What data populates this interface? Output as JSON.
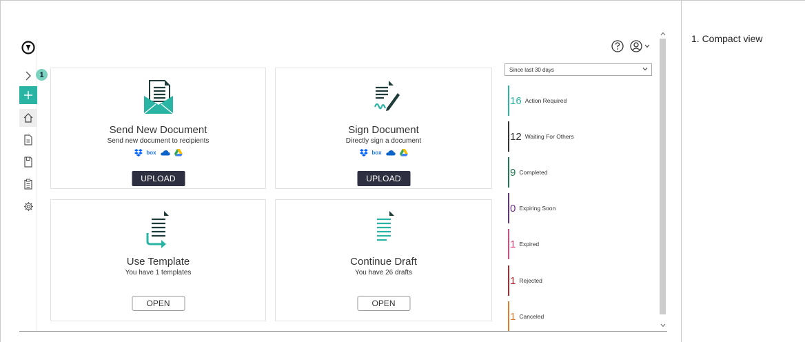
{
  "note": {
    "text": "1.  Compact view"
  },
  "nav": {
    "badge": "1",
    "items": [
      {
        "name": "expand",
        "icon": "chevron-right-icon"
      },
      {
        "name": "new",
        "icon": "plus-icon"
      },
      {
        "name": "home",
        "icon": "home-icon"
      },
      {
        "name": "documents",
        "icon": "document-icon"
      },
      {
        "name": "drafts",
        "icon": "save-icon"
      },
      {
        "name": "templates",
        "icon": "clipboard-icon"
      },
      {
        "name": "settings",
        "icon": "gear-icon"
      }
    ]
  },
  "header": {
    "help_icon": "help-icon",
    "user_icon": "user-icon"
  },
  "cards": {
    "send": {
      "title": "Send New Document",
      "subtitle": "Send new document to recipients",
      "button": "UPLOAD"
    },
    "sign": {
      "title": "Sign Document",
      "subtitle": "Directly sign a document",
      "button": "UPLOAD"
    },
    "template": {
      "title": "Use Template",
      "subtitle": "You have 1 templates",
      "button": "OPEN"
    },
    "draft": {
      "title": "Continue Draft",
      "subtitle": "You have 26 drafts",
      "button": "OPEN"
    }
  },
  "services": {
    "dropbox": "dropbox-icon",
    "box": "box",
    "onedrive": "onedrive-icon",
    "gdrive": "google-drive-icon"
  },
  "panel": {
    "period": "Since last 30 days",
    "stats": [
      {
        "count": "16",
        "label": "Action Required",
        "color": "#2ab4a3"
      },
      {
        "count": "12",
        "label": "Waiting For Others",
        "color": "#333333"
      },
      {
        "count": "9",
        "label": "Completed",
        "color": "#1e7a4f"
      },
      {
        "count": "0",
        "label": "Expiring Soon",
        "color": "#6b2f86"
      },
      {
        "count": "1",
        "label": "Expired",
        "color": "#e0457b"
      },
      {
        "count": "1",
        "label": "Rejected",
        "color": "#b3262c"
      },
      {
        "count": "1",
        "label": "Canceled",
        "color": "#e07b2a"
      }
    ]
  },
  "colors": {
    "accent": "#2ab4a3",
    "dark_button": "#2e3042",
    "icon_dark": "#1f3b3a"
  }
}
